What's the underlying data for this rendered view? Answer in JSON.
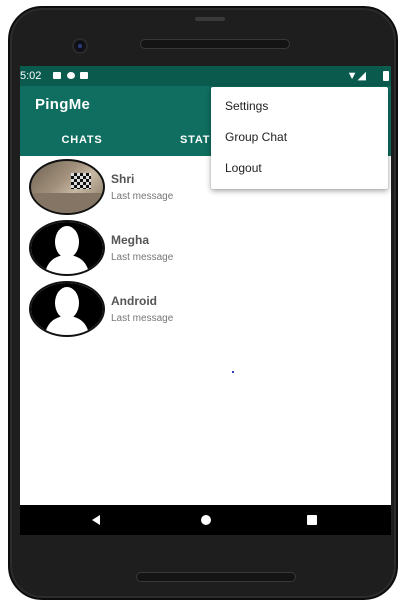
{
  "status_bar": {
    "time": "5:02",
    "icons": [
      "notification-icon",
      "sync-icon",
      "sd-card-icon",
      "wifi-icon",
      "signal-icon",
      "battery-icon"
    ]
  },
  "app": {
    "title": "PingMe",
    "accent_color": "#0f6e5f",
    "status_bar_color": "#0b5a4e"
  },
  "tabs": [
    {
      "label": "CHATS",
      "selected": true
    },
    {
      "label": "STAT",
      "selected": false
    }
  ],
  "overflow_menu": {
    "items": [
      {
        "label": "Settings"
      },
      {
        "label": "Group Chat"
      },
      {
        "label": "Logout"
      }
    ]
  },
  "chats": [
    {
      "name": "Shri",
      "preview": "Last message",
      "avatar": "photo"
    },
    {
      "name": "Megha",
      "preview": "Last message",
      "avatar": "default-person-icon"
    },
    {
      "name": "Android",
      "preview": "Last message",
      "avatar": "default-person-icon"
    }
  ],
  "nav_bar": {
    "icons": [
      "back-icon",
      "home-icon",
      "recents-icon"
    ]
  }
}
